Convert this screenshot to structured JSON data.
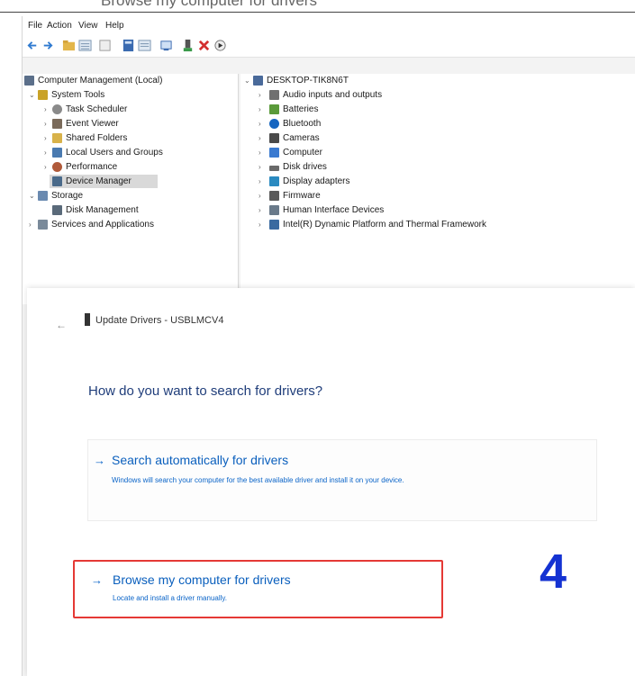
{
  "caption_fragment": "Browse my computer for drivers",
  "menubar": {
    "items": [
      "File",
      "Action",
      "View",
      "Help"
    ]
  },
  "toolbar": {
    "icons": [
      "back-arrow-icon",
      "forward-arrow-icon",
      "folder-up-icon",
      "list-view-icon",
      "details-view-icon",
      "properties-icon",
      "help-icon",
      "scan-icon",
      "update-driver-icon",
      "remove-icon",
      "enable-icon"
    ],
    "delete_color": "#d32f2f"
  },
  "left_tree": [
    {
      "label": "Computer Management (Local)",
      "expander": "",
      "icon": "computer-management-icon",
      "color": "#5b6f8a"
    },
    {
      "label": "System Tools",
      "expander": "⌄",
      "icon": "toolbox-icon",
      "color": "#c9a227"
    },
    {
      "label": "Task Scheduler",
      "expander": "›",
      "icon": "clock-icon",
      "color": "#8a8a8a"
    },
    {
      "label": "Event Viewer",
      "expander": "›",
      "icon": "event-viewer-icon",
      "color": "#7a6a5a"
    },
    {
      "label": "Shared Folders",
      "expander": "›",
      "icon": "shared-folder-icon",
      "color": "#d8b24a"
    },
    {
      "label": "Local Users and Groups",
      "expander": "›",
      "icon": "users-icon",
      "color": "#4a7ab0"
    },
    {
      "label": "Performance",
      "expander": "›",
      "icon": "performance-icon",
      "color": "#b05a3a"
    },
    {
      "label": "Device Manager",
      "expander": "",
      "icon": "device-manager-icon",
      "color": "#4a6a8a"
    },
    {
      "label": "Storage",
      "expander": "⌄",
      "icon": "storage-icon",
      "color": "#6a8ab0"
    },
    {
      "label": "Disk Management",
      "expander": "",
      "icon": "disk-management-icon",
      "color": "#5a6a7a"
    },
    {
      "label": "Services and Applications",
      "expander": "›",
      "icon": "services-icon",
      "color": "#7a8a9a"
    }
  ],
  "right_tree": [
    {
      "label": "DESKTOP-TIK8N6T",
      "expander": "⌄",
      "icon": "computer-icon",
      "color": "#4a6a9a"
    },
    {
      "label": "Audio inputs and outputs",
      "expander": "›",
      "icon": "audio-icon",
      "color": "#707070"
    },
    {
      "label": "Batteries",
      "expander": "›",
      "icon": "battery-icon",
      "color": "#5a9a3a"
    },
    {
      "label": "Bluetooth",
      "expander": "›",
      "icon": "bluetooth-icon",
      "color": "#1565c0"
    },
    {
      "label": "Cameras",
      "expander": "›",
      "icon": "camera-icon",
      "color": "#4a4a4a"
    },
    {
      "label": "Computer",
      "expander": "›",
      "icon": "monitor-icon",
      "color": "#3a7ad0"
    },
    {
      "label": "Disk drives",
      "expander": "›",
      "icon": "disk-drive-icon",
      "color": "#6a6a6a"
    },
    {
      "label": "Display adapters",
      "expander": "›",
      "icon": "display-adapter-icon",
      "color": "#2a8ac0"
    },
    {
      "label": "Firmware",
      "expander": "›",
      "icon": "firmware-icon",
      "color": "#5a5a5a"
    },
    {
      "label": "Human Interface Devices",
      "expander": "›",
      "icon": "hid-icon",
      "color": "#6a7a8a"
    },
    {
      "label": "Intel(R) Dynamic Platform and Thermal Framework",
      "expander": "›",
      "icon": "chip-icon",
      "color": "#3a6aa0"
    }
  ],
  "dialog": {
    "back_glyph": "←",
    "title": "Update Drivers - USBLMCV4",
    "heading": "How do you want to search for drivers?",
    "option_auto": {
      "arrow": "→",
      "title": "Search automatically for drivers",
      "description": "Windows will search your computer for the best available driver and install it on your device."
    },
    "option_browse": {
      "arrow": "→",
      "title": "Browse my computer for drivers",
      "description": "Locate and install a driver manually."
    },
    "highlight_color": "#e53935"
  },
  "step_label": "4",
  "step_color": "#1432d2"
}
